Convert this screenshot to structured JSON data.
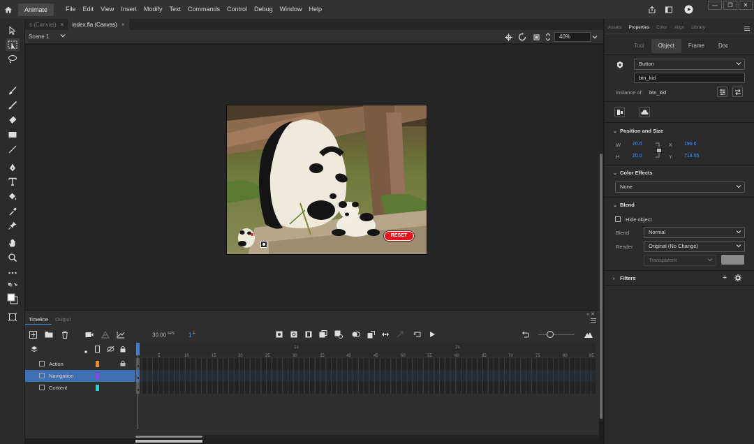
{
  "menubar": {
    "app_name": "Animate",
    "items": [
      "File",
      "Edit",
      "View",
      "Insert",
      "Modify",
      "Text",
      "Commands",
      "Control",
      "Debug",
      "Window",
      "Help"
    ]
  },
  "doc_tabs": [
    {
      "label": "s (Canvas)",
      "close": "×"
    },
    {
      "label": "index.fla (Canvas)",
      "close": "×"
    }
  ],
  "scene": {
    "label": "Scene 1",
    "zoom": "40%"
  },
  "stage": {
    "reset_label": "RESET"
  },
  "timeline": {
    "tabs": [
      "Timeline",
      "Output"
    ],
    "fps": "30.00",
    "fps_unit": "FPS",
    "frame": "1",
    "frame_unit": "F",
    "ruler_ticks": [
      "5",
      "10",
      "15",
      "20",
      "25",
      "30",
      "35",
      "40",
      "45",
      "50",
      "55",
      "60",
      "65",
      "70",
      "75",
      "80",
      "85"
    ],
    "ruler_seconds": [
      "1s",
      "2s"
    ],
    "layers": [
      {
        "name": "Action",
        "color": "#f08a1e",
        "locked": true
      },
      {
        "name": "Navigation",
        "color": "#9b3cf0",
        "locked": false,
        "selected": true
      },
      {
        "name": "Content",
        "color": "#22d5d5",
        "locked": false
      }
    ]
  },
  "properties": {
    "tabs": [
      "Assets",
      "Properties",
      "Color",
      "Align",
      "Library"
    ],
    "active_tab": "Properties",
    "segments": [
      "Tool",
      "Object",
      "Frame",
      "Doc"
    ],
    "active_segment": "Object",
    "symbol_type": "Button",
    "instance_name": "btn_kid",
    "instance_of_label": "Instance of:",
    "instance_of_value": "btn_kid",
    "position_size": {
      "title": "Position and Size",
      "w_label": "W",
      "w": "20.6",
      "h_label": "H",
      "h": "20.6",
      "x_label": "X",
      "x": "190.6",
      "y_label": "Y",
      "y": "718.05"
    },
    "color_effects": {
      "title": "Color Effects",
      "value": "None"
    },
    "blend": {
      "title": "Blend",
      "hide_object": "Hide object",
      "blend_label": "Blend",
      "blend_value": "Normal",
      "render_label": "Render",
      "render_value": "Original (No Change)",
      "transparent": "Transparent"
    },
    "filters": {
      "title": "Filters"
    }
  },
  "colors": {
    "accent": "#3a7ee0",
    "selection": "#3d6fb2",
    "reset_button": "#e0161c"
  }
}
